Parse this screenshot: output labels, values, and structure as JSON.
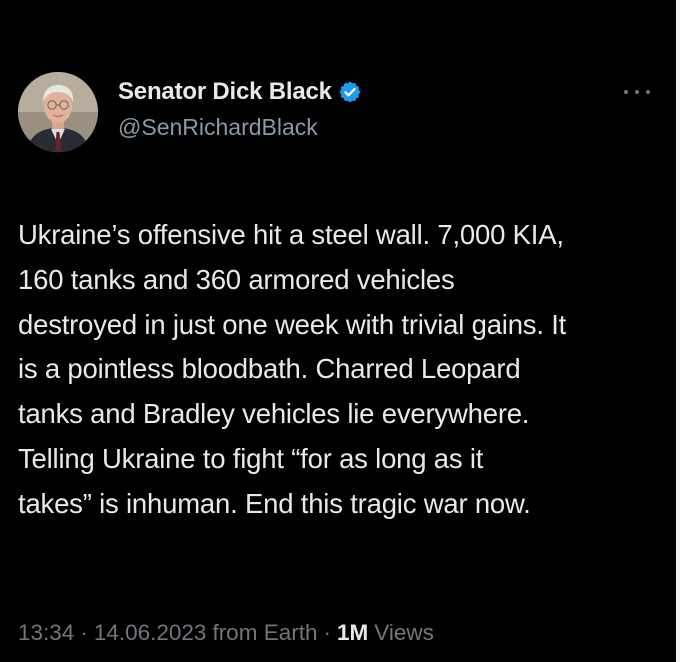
{
  "tweet": {
    "author": {
      "name": "Senator Dick Black",
      "handle": "@SenRichardBlack",
      "verified": true,
      "verified_icon": "verified-check-icon",
      "verified_color": "#1d9bf0"
    },
    "more_icon": "more-options-icon",
    "text": "Ukraine’s offensive hit a steel wall. 7,000 KIA,\n160 tanks and 360 armored vehicles\ndestroyed in just one week with trivial gains. It\nis a pointless bloodbath. Charred Leopard\ntanks and Bradley vehicles lie everywhere.\nTelling Ukraine to fight “for as long as it\ntakes” is inhuman. End this tragic war now.",
    "time": "13:34",
    "separator": "·",
    "date": "14.06.2023",
    "source": "from Earth",
    "views_count": "1M",
    "views_label": "Views"
  },
  "colors": {
    "background": "#000000",
    "text": "#e7e9ea",
    "secondary_text": "#8b98a5",
    "meta_text": "#71767b"
  }
}
